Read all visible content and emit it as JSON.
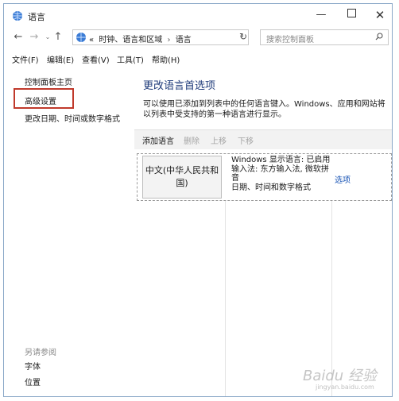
{
  "window": {
    "title": "语言",
    "minimize": "—",
    "close": "✕"
  },
  "nav": {
    "back": "←",
    "forward": "→",
    "recent": "⌄",
    "up": "↑",
    "address": {
      "prefix": "«",
      "segments": [
        "时钟、语言和区域",
        "语言"
      ],
      "separator": "›",
      "dropdown": "⌄"
    },
    "refresh": "↻",
    "search_placeholder": "搜索控制面板"
  },
  "menu": [
    "文件(F)",
    "编辑(E)",
    "查看(V)",
    "工具(T)",
    "帮助(H)"
  ],
  "left_pane": {
    "home": "控制面板主页",
    "advanced": "高级设置",
    "datetime": "更改日期、时间或数字格式",
    "see_also": "另请参阅",
    "fonts": "字体",
    "location": "位置"
  },
  "main": {
    "title": "更改语言首选项",
    "description": "可以使用已添加到列表中的任何语言键入。Windows、应用和网站将以列表中受支持的第一种语言进行显示。",
    "toolbar": {
      "add": "添加语言",
      "remove": "删除",
      "up": "上移",
      "down": "下移"
    },
    "languages": [
      {
        "name": "中文(中华人民共和国)",
        "info": [
          "Windows 显示语言: 已启用",
          "输入法: 东方输入法, 微软拼音",
          "日期、时间和数字格式"
        ],
        "option": "选项"
      }
    ]
  },
  "watermark": {
    "text": "Baidu 经验",
    "sub": "jingyan.baidu.com"
  }
}
